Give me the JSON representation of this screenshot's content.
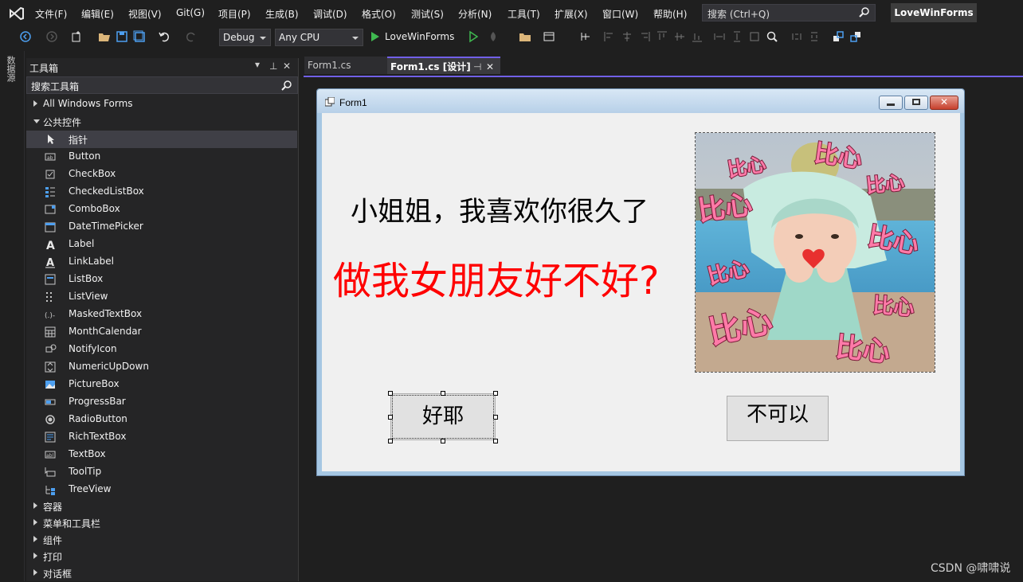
{
  "menu": {
    "items": [
      "文件(F)",
      "编辑(E)",
      "视图(V)",
      "Git(G)",
      "项目(P)",
      "生成(B)",
      "调试(D)",
      "格式(O)",
      "测试(S)",
      "分析(N)",
      "工具(T)",
      "扩展(X)",
      "窗口(W)",
      "帮助(H)"
    ],
    "search_placeholder": "搜索 (Ctrl+Q)",
    "solution_name": "LoveWinForms"
  },
  "toolbar": {
    "config": "Debug",
    "platform": "Any CPU",
    "run_target": "LoveWinForms"
  },
  "side_strip": {
    "label": "数据源"
  },
  "toolbox": {
    "title": "工具箱",
    "search_placeholder": "搜索工具箱",
    "categories_top": [
      {
        "label": "All Windows Forms",
        "expanded": false
      },
      {
        "label": "公共控件",
        "expanded": true
      }
    ],
    "items": [
      {
        "label": "指针",
        "icon": "pointer-icon",
        "selected": true
      },
      {
        "label": "Button",
        "icon": "button-icon"
      },
      {
        "label": "CheckBox",
        "icon": "checkbox-icon"
      },
      {
        "label": "CheckedListBox",
        "icon": "checkedlistbox-icon"
      },
      {
        "label": "ComboBox",
        "icon": "combobox-icon"
      },
      {
        "label": "DateTimePicker",
        "icon": "datetimepicker-icon"
      },
      {
        "label": "Label",
        "icon": "label-icon"
      },
      {
        "label": "LinkLabel",
        "icon": "linklabel-icon"
      },
      {
        "label": "ListBox",
        "icon": "listbox-icon"
      },
      {
        "label": "ListView",
        "icon": "listview-icon"
      },
      {
        "label": "MaskedTextBox",
        "icon": "maskedtextbox-icon"
      },
      {
        "label": "MonthCalendar",
        "icon": "monthcalendar-icon"
      },
      {
        "label": "NotifyIcon",
        "icon": "notifyicon-icon"
      },
      {
        "label": "NumericUpDown",
        "icon": "numericupdown-icon"
      },
      {
        "label": "PictureBox",
        "icon": "picturebox-icon"
      },
      {
        "label": "ProgressBar",
        "icon": "progressbar-icon"
      },
      {
        "label": "RadioButton",
        "icon": "radiobutton-icon"
      },
      {
        "label": "RichTextBox",
        "icon": "richtextbox-icon"
      },
      {
        "label": "TextBox",
        "icon": "textbox-icon"
      },
      {
        "label": "ToolTip",
        "icon": "tooltip-icon"
      },
      {
        "label": "TreeView",
        "icon": "treeview-icon"
      }
    ],
    "categories_bottom": [
      {
        "label": "容器"
      },
      {
        "label": "菜单和工具栏"
      },
      {
        "label": "组件"
      },
      {
        "label": "打印"
      },
      {
        "label": "对话框"
      }
    ]
  },
  "doc_tabs": [
    {
      "label": "Form1.cs",
      "active": false
    },
    {
      "label": "Form1.cs [设计]",
      "active": true
    }
  ],
  "form": {
    "title": "Form1",
    "label_line1": "小姐姐，我喜欢你很久了",
    "label_line2": "做我女朋友好不好?",
    "yes_button": "好耶",
    "no_button": "不可以",
    "picture_stickers": [
      "比心",
      "比心",
      "比心",
      "比心",
      "比心",
      "比心",
      "比心",
      "比心",
      "比心",
      "比心"
    ]
  },
  "colors": {
    "accent": "#7160e8",
    "label_red": "#ff0000",
    "sticker_pink": "#ff7aa8"
  },
  "watermark": "CSDN @啸啸说"
}
